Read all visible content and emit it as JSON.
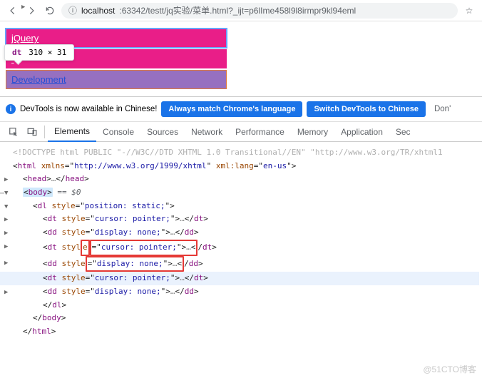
{
  "browser": {
    "url_prefix": "localhost",
    "url_rest": ":63342/testt/jq实验/菜单.html?_ijt=p6lIme458l9l8irmpr9kl94eml"
  },
  "page": {
    "dt_highlighted": "jQuery",
    "dd_visible": "Development",
    "dim_tag": "dt",
    "dim_value": "310 × 31"
  },
  "devtools": {
    "banner": {
      "msg": "DevTools is now available in Chinese!",
      "btn_always": "Always match Chrome's language",
      "btn_switch": "Switch DevTools to Chinese",
      "btn_dont": "Don'"
    },
    "tabs": {
      "elements": "Elements",
      "console": "Console",
      "sources": "Sources",
      "network": "Network",
      "performance": "Performance",
      "memory": "Memory",
      "application": "Application",
      "security": "Sec"
    },
    "source": {
      "doctype": "<!DOCTYPE html PUBLIC \"-//W3C//DTD XHTML 1.0 Transitional//EN\" \"http://www.w3.org/TR/xhtml1",
      "html_open_xmlns": "http://www.w3.org/1999/xhtml",
      "html_open_lang": "en-us",
      "body_sel": " == $0",
      "dl_style": "position: static;",
      "dt_style": "cursor: pointer;",
      "dd_style": "display: none;"
    }
  },
  "watermark": "@51CTO博客"
}
